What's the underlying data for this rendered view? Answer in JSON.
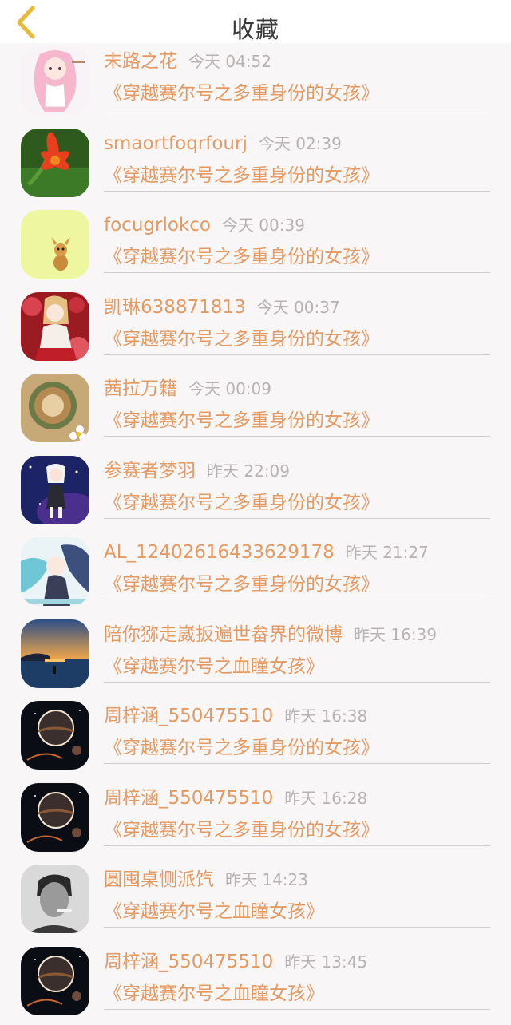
{
  "header": {
    "title": "收藏"
  },
  "items": [
    {
      "user": "末路之花",
      "time": "今天 04:52",
      "book": "《穿越赛尔号之多重身份的女孩》",
      "avatar": "anime-girl-avatar"
    },
    {
      "user": "smaortfoqrfourj",
      "time": "今天 02:39",
      "book": "《穿越赛尔号之多重身份的女孩》",
      "avatar": "red-lily-avatar"
    },
    {
      "user": "focugrlokco",
      "time": "今天 00:39",
      "book": "《穿越赛尔号之多重身份的女孩》",
      "avatar": "yellow-mascot-avatar"
    },
    {
      "user": "凯琳638871813",
      "time": "今天 00:37",
      "book": "《穿越赛尔号之多重身份的女孩》",
      "avatar": "anime-girl-flowers-avatar"
    },
    {
      "user": "茜拉万籍",
      "time": "今天 00:09",
      "book": "《穿越赛尔号之多重身份的女孩》",
      "avatar": "coffee-cup-avatar"
    },
    {
      "user": "参赛者梦羽",
      "time": "昨天 22:09",
      "book": "《穿越赛尔号之多重身份的女孩》",
      "avatar": "anime-character-space-avatar"
    },
    {
      "user": "AL_12402616433629178",
      "time": "昨天 21:27",
      "book": "《穿越赛尔号之多重身份的女孩》",
      "avatar": "anime-blue-hair-avatar"
    },
    {
      "user": "陪你猕走崴扳遍世畚界的微博",
      "time": "昨天 16:39",
      "book": "《穿越赛尔号之血瞳女孩》",
      "avatar": "sunset-sea-avatar"
    },
    {
      "user": "周梓涵_550475510",
      "time": "昨天 16:38",
      "book": "《穿越赛尔号之多重身份的女孩》",
      "avatar": "planet-eclipse-avatar"
    },
    {
      "user": "周梓涵_550475510",
      "time": "昨天 16:28",
      "book": "《穿越赛尔号之多重身份的女孩》",
      "avatar": "planet-eclipse-avatar"
    },
    {
      "user": "圆囤桌恻派饩",
      "time": "昨天 14:23",
      "book": "《穿越赛尔号之血瞳女孩》",
      "avatar": "man-smoking-avatar"
    },
    {
      "user": "周梓涵_550475510",
      "time": "昨天 13:45",
      "book": "《穿越赛尔号之血瞳女孩》",
      "avatar": "planet-eclipse-avatar"
    }
  ],
  "colors": {
    "accent": "#e49a63",
    "time": "#b7b3b3",
    "back_icon": "#e8b93a"
  }
}
